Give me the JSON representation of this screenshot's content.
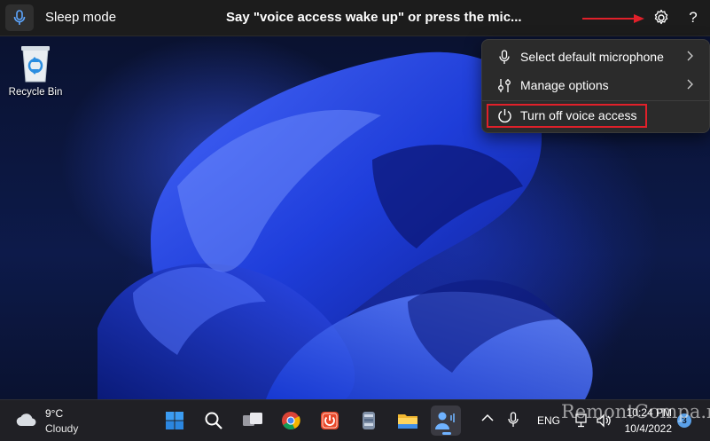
{
  "voice_access_bar": {
    "status": "Sleep mode",
    "hint": "Say \"voice access wake up\" or press the mic...",
    "help_label": "?",
    "mic_icon": "microphone-icon",
    "settings_icon": "gear-icon"
  },
  "settings_menu": {
    "items": [
      {
        "label": "Select default microphone",
        "icon": "microphone-icon",
        "has_submenu": true
      },
      {
        "label": "Manage options",
        "icon": "settings-sliders-icon",
        "has_submenu": true
      },
      {
        "label": "Turn off voice access",
        "icon": "power-icon",
        "has_submenu": false
      }
    ],
    "highlight_color": "#e0202a"
  },
  "desktop": {
    "icons": [
      {
        "label": "Recycle Bin",
        "icon": "recycle-bin-icon"
      }
    ]
  },
  "taskbar": {
    "weather": {
      "temp": "9°C",
      "condition": "Cloudy",
      "icon": "cloud-icon"
    },
    "apps": [
      {
        "name": "start",
        "icon": "windows-logo-icon"
      },
      {
        "name": "search",
        "icon": "search-icon"
      },
      {
        "name": "task-view",
        "icon": "task-view-icon"
      },
      {
        "name": "chrome",
        "icon": "chrome-icon"
      },
      {
        "name": "power-app",
        "icon": "power-app-icon"
      },
      {
        "name": "archive",
        "icon": "archive-icon"
      },
      {
        "name": "file-explorer",
        "icon": "folder-icon"
      },
      {
        "name": "voice-access",
        "icon": "voice-access-icon",
        "active": true
      }
    ],
    "tray": {
      "language": "ENG",
      "time": "10:24 PM",
      "date": "10/4/2022",
      "notification_count": "3"
    }
  },
  "watermark": "RemontCompa.ru",
  "colors": {
    "bar_bg": "#1c1c1c",
    "menu_bg": "#2b2b2b",
    "taskbar_bg": "#202025",
    "accent_blue": "#6fb2ff",
    "annotation_red": "#e0202a"
  }
}
